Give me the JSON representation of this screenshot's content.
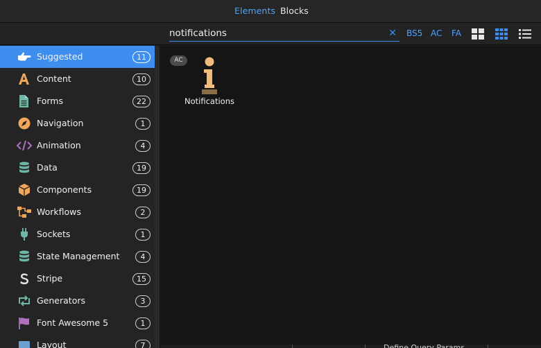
{
  "header": {
    "tabs": [
      {
        "label": "Elements",
        "active": true
      },
      {
        "label": "Blocks",
        "active": false
      }
    ]
  },
  "search": {
    "value": "notifications",
    "placeholder": "",
    "filters": [
      "BS5",
      "AC",
      "FA"
    ]
  },
  "sidebar": {
    "items": [
      {
        "label": "Suggested",
        "count": "11",
        "icon": "pointing-hand-icon",
        "active": true
      },
      {
        "label": "Content",
        "count": "10",
        "icon": "font-letter-icon"
      },
      {
        "label": "Forms",
        "count": "22",
        "icon": "document-icon"
      },
      {
        "label": "Navigation",
        "count": "1",
        "icon": "compass-icon"
      },
      {
        "label": "Animation",
        "count": "4",
        "icon": "code-icon"
      },
      {
        "label": "Data",
        "count": "19",
        "icon": "database-icon"
      },
      {
        "label": "Components",
        "count": "19",
        "icon": "cube-icon"
      },
      {
        "label": "Workflows",
        "count": "2",
        "icon": "sitemap-icon"
      },
      {
        "label": "Sockets",
        "count": "1",
        "icon": "plug-icon"
      },
      {
        "label": "State Management",
        "count": "4",
        "icon": "database-icon"
      },
      {
        "label": "Stripe",
        "count": "15",
        "icon": "stripe-s-icon"
      },
      {
        "label": "Generators",
        "count": "3",
        "icon": "retweet-icon"
      },
      {
        "label": "Font Awesome 5",
        "count": "1",
        "icon": "flag-icon"
      },
      {
        "label": "Layout",
        "count": "7",
        "icon": "layout-icon"
      }
    ]
  },
  "results": {
    "badge": "AC",
    "items": [
      {
        "label": "Notifications",
        "icon": "info-icon"
      }
    ]
  },
  "background": {
    "peek_text": "Define Query Params"
  },
  "colors": {
    "accent": "#3e8ef0",
    "link": "#4aa3ff",
    "icon_orange": "#f0a75a",
    "icon_teal": "#6fb8a8",
    "icon_purple": "#b070c0"
  }
}
